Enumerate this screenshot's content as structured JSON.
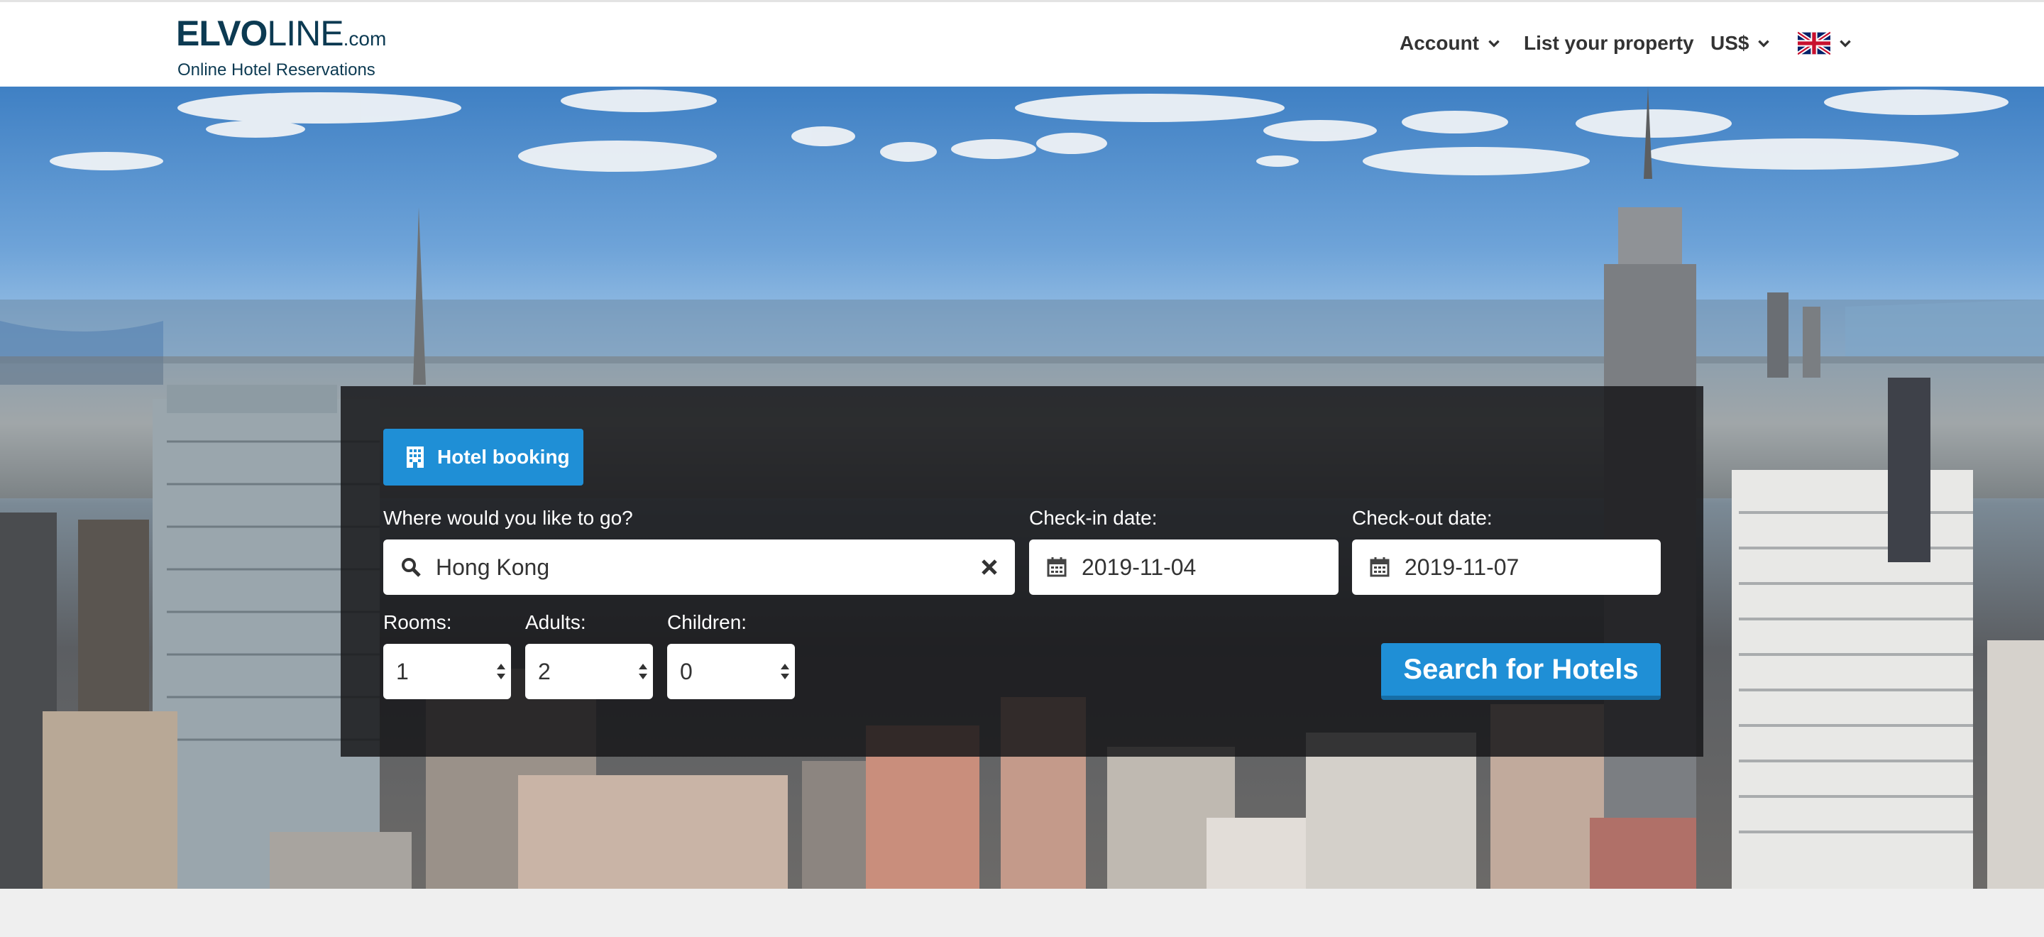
{
  "header": {
    "logo": {
      "part1": "ELVO",
      "part2": "LINE",
      "domain": ".com",
      "tagline": "Online Hotel Reservations"
    },
    "nav": {
      "account": "Account",
      "list_property": "List your property",
      "currency": "US$",
      "language_icon": "uk-flag-icon"
    }
  },
  "search": {
    "tab_label": "Hotel booking",
    "tab_icon": "building-icon",
    "destination": {
      "label": "Where would you like to go?",
      "value": "Hong Kong"
    },
    "checkin": {
      "label": "Check-in date:",
      "value": "2019-11-04"
    },
    "checkout": {
      "label": "Check-out date:",
      "value": "2019-11-07"
    },
    "rooms": {
      "label": "Rooms:",
      "value": "1"
    },
    "adults": {
      "label": "Adults:",
      "value": "2"
    },
    "children": {
      "label": "Children:",
      "value": "0"
    },
    "button": "Search for Hotels"
  },
  "colors": {
    "accent": "#1f8fd6",
    "brand": "#0c3a52",
    "panel": "#161618"
  }
}
